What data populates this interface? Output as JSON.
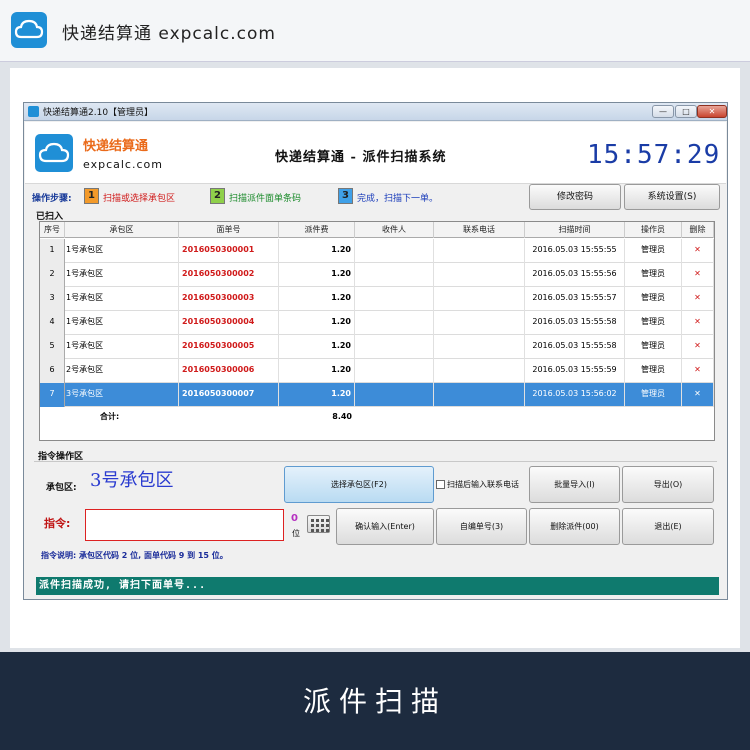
{
  "brand": {
    "title": "快递结算通 expcalc.com"
  },
  "window": {
    "title": "快递结算通2.10【管理员】",
    "min_glyph": "—",
    "max_glyph": "□",
    "close_glyph": "✕"
  },
  "app_header": {
    "brand": "快递结算通",
    "domain": "expcalc.com",
    "system_title": "快递结算通 - 派件扫描系统",
    "clock": "15:57:29"
  },
  "steps": {
    "label": "操作步骤:",
    "items": [
      {
        "num": "1",
        "text": "扫描或选择承包区",
        "color": "#d01a1a",
        "box": "#f39a2a"
      },
      {
        "num": "2",
        "text": "扫描派件面单条码",
        "color": "#1a8a2a",
        "box": "#8fd04a"
      },
      {
        "num": "3",
        "text": "完成，扫描下一单。",
        "color": "#1a3cba",
        "box": "#3fa0e8"
      }
    ]
  },
  "top_buttons": {
    "change_password": "修改密码",
    "settings": "系统设置(S)"
  },
  "scanned": {
    "label": "已扫入",
    "columns": [
      "序号",
      "承包区",
      "面单号",
      "派件费",
      "收件人",
      "联系电话",
      "扫描时间",
      "操作员",
      "删除"
    ],
    "rows": [
      {
        "idx": "1",
        "zone": "1号承包区",
        "waybill": "2016050300001",
        "fee": "1.20",
        "recipient": "",
        "phone": "",
        "time": "2016.05.03 15:55:55",
        "operator": "管理员",
        "del": "✕"
      },
      {
        "idx": "2",
        "zone": "1号承包区",
        "waybill": "2016050300002",
        "fee": "1.20",
        "recipient": "",
        "phone": "",
        "time": "2016.05.03 15:55:56",
        "operator": "管理员",
        "del": "✕"
      },
      {
        "idx": "3",
        "zone": "1号承包区",
        "waybill": "2016050300003",
        "fee": "1.20",
        "recipient": "",
        "phone": "",
        "time": "2016.05.03 15:55:57",
        "operator": "管理员",
        "del": "✕"
      },
      {
        "idx": "4",
        "zone": "1号承包区",
        "waybill": "2016050300004",
        "fee": "1.20",
        "recipient": "",
        "phone": "",
        "time": "2016.05.03 15:55:58",
        "operator": "管理员",
        "del": "✕"
      },
      {
        "idx": "5",
        "zone": "1号承包区",
        "waybill": "2016050300005",
        "fee": "1.20",
        "recipient": "",
        "phone": "",
        "time": "2016.05.03 15:55:58",
        "operator": "管理员",
        "del": "✕"
      },
      {
        "idx": "6",
        "zone": "2号承包区",
        "waybill": "2016050300006",
        "fee": "1.20",
        "recipient": "",
        "phone": "",
        "time": "2016.05.03 15:55:59",
        "operator": "管理员",
        "del": "✕"
      },
      {
        "idx": "7",
        "zone": "3号承包区",
        "waybill": "2016050300007",
        "fee": "1.20",
        "recipient": "",
        "phone": "",
        "time": "2016.05.03 15:56:02",
        "operator": "管理员",
        "del": "✕",
        "selected": true
      }
    ],
    "total_label": "合计:",
    "total_value": "8.40"
  },
  "command": {
    "section_label": "指令操作区",
    "zone_label": "承包区:",
    "zone_value": "3号承包区",
    "select_zone_button": "选择承包区(F2)",
    "checkbox_label": "扫描后输入联系电话",
    "batch_import": "批量导入(I)",
    "export": "导出(O)",
    "cmd_label": "指令:",
    "cmd_value": "",
    "digit_count": "0",
    "digit_unit": "位",
    "confirm_button": "确认输入(Enter)",
    "self_number_button": "自编单号(3)",
    "delete_button": "删除派件(00)",
    "exit_button": "退出(E)",
    "help": "指令说明: 承包区代码 2 位, 面单代码 9 到 15 位。"
  },
  "status": {
    "message": "派件扫描成功, 请扫下面单号..."
  },
  "banner": {
    "text": "派件扫描"
  }
}
